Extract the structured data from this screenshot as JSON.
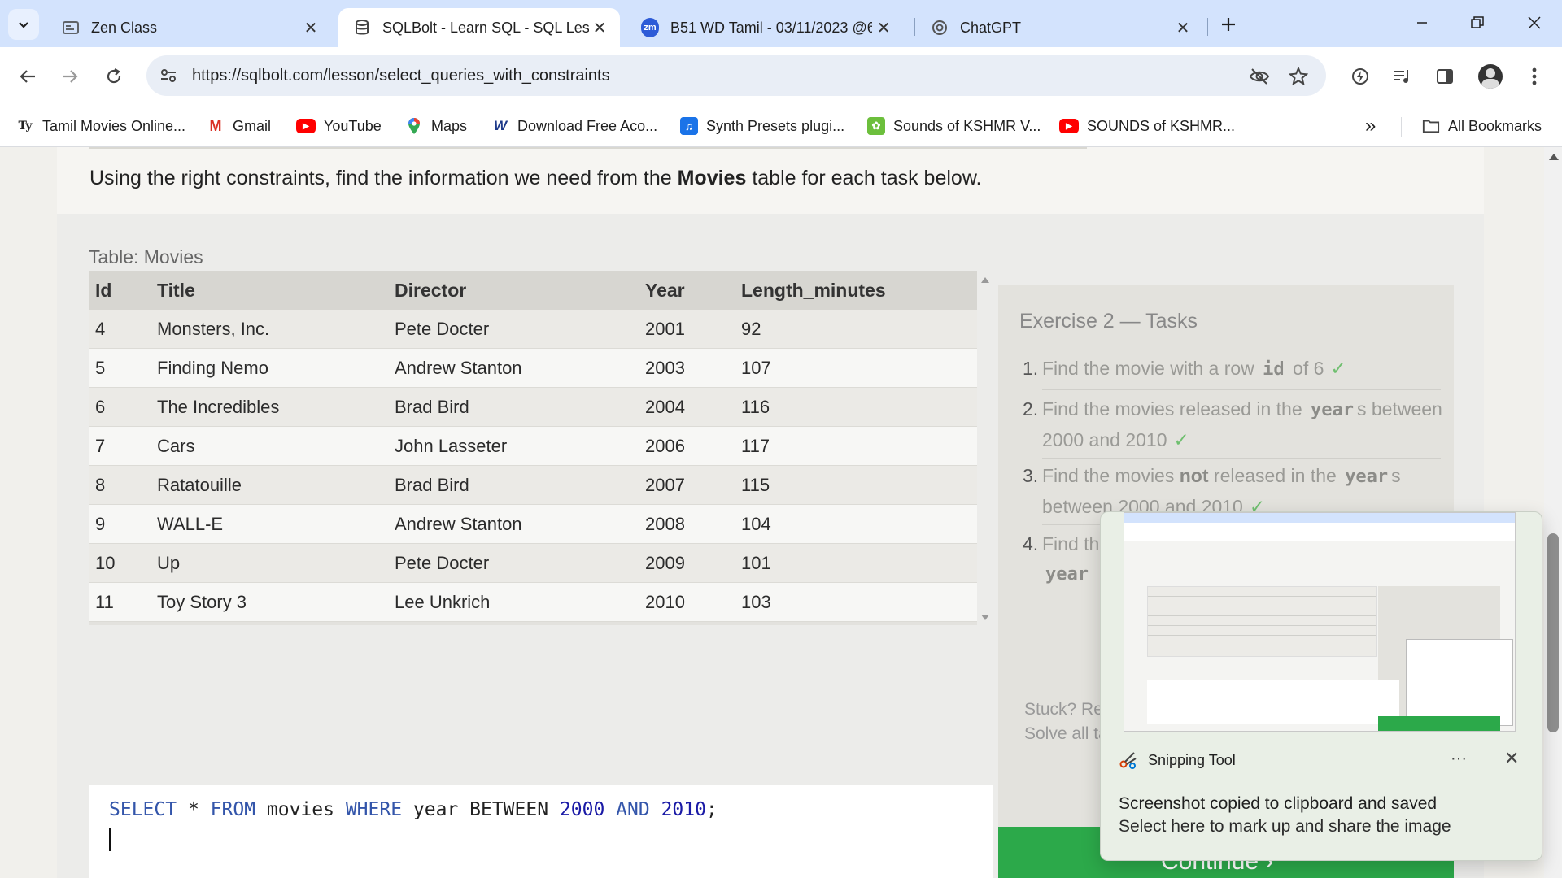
{
  "browser": {
    "tabs": [
      {
        "title": "Zen Class",
        "icon": "zen-class-icon",
        "active": false
      },
      {
        "title": "SQLBolt - Learn SQL - SQL Lesso",
        "icon": "database-icon",
        "active": true
      },
      {
        "title": "B51 WD Tamil - 03/11/2023 @6",
        "icon": "zoom-icon",
        "active": false
      },
      {
        "title": "ChatGPT",
        "icon": "chatgpt-icon",
        "active": false
      }
    ],
    "zoom_badge": "zm",
    "url": "https://sqlbolt.com/lesson/select_queries_with_constraints",
    "bookmarks": [
      {
        "label": "Tamil Movies Online...",
        "icon": "ty-icon",
        "glyph": "Ty"
      },
      {
        "label": "Gmail",
        "icon": "gmail-icon",
        "glyph": "M"
      },
      {
        "label": "YouTube",
        "icon": "youtube-icon",
        "glyph": "▶"
      },
      {
        "label": "Maps",
        "icon": "maps-pin-icon",
        "glyph": ""
      },
      {
        "label": "Download Free Aco...",
        "icon": "wix-icon",
        "glyph": "W"
      },
      {
        "label": "Synth Presets plugi...",
        "icon": "music-note-icon",
        "glyph": "♫"
      },
      {
        "label": "Sounds of KSHMR V...",
        "icon": "splice-icon",
        "glyph": "✿"
      },
      {
        "label": "SOUNDS of KSHMR...",
        "icon": "youtube-icon",
        "glyph": "▶"
      }
    ],
    "overflow_label": "»",
    "all_bookmarks_label": "All Bookmarks"
  },
  "page": {
    "intro_prefix": "Using the right constraints, find the information we need from the ",
    "intro_bold": "Movies",
    "intro_suffix": " table for each task below.",
    "table_caption": "Table: Movies",
    "columns": [
      "Id",
      "Title",
      "Director",
      "Year",
      "Length_minutes"
    ],
    "rows": [
      [
        "4",
        "Monsters, Inc.",
        "Pete Docter",
        "2001",
        "92"
      ],
      [
        "5",
        "Finding Nemo",
        "Andrew Stanton",
        "2003",
        "107"
      ],
      [
        "6",
        "The Incredibles",
        "Brad Bird",
        "2004",
        "116"
      ],
      [
        "7",
        "Cars",
        "John Lasseter",
        "2006",
        "117"
      ],
      [
        "8",
        "Ratatouille",
        "Brad Bird",
        "2007",
        "115"
      ],
      [
        "9",
        "WALL-E",
        "Andrew Stanton",
        "2008",
        "104"
      ],
      [
        "10",
        "Up",
        "Pete Docter",
        "2009",
        "101"
      ],
      [
        "11",
        "Toy Story 3",
        "Lee Unkrich",
        "2010",
        "103"
      ]
    ],
    "query": {
      "kw_select": "SELECT",
      "star": " * ",
      "kw_from": "FROM",
      "table": " movies ",
      "kw_where": "WHERE",
      "col": " year BETWEEN ",
      "n1": "2000",
      "kw_and": " AND ",
      "n2": "2010",
      "end": ";"
    },
    "exercise_title": "Exercise 2 — Tasks",
    "tasks": [
      {
        "num": "1.",
        "a": "Find the movie with a row ",
        "code": "id",
        "b": " of 6",
        "check": "✓"
      },
      {
        "num": "2.",
        "a": "Find the movies released in the ",
        "code": "year",
        "b": "s between 2000 and 2010",
        "check": "✓"
      },
      {
        "num": "3.",
        "a": "Find the movies ",
        "strong": "not",
        "a2": " released in the ",
        "code": "year",
        "b": "s between 2000 and 2010",
        "check": "✓"
      },
      {
        "num": "4.",
        "a": "Find th",
        "code": "year"
      }
    ],
    "stuck_line1": "Stuck? Rea",
    "stuck_line2": "Solve all ta",
    "continue_label": "Continue ›"
  },
  "snipping_tool": {
    "app_name": "Snipping Tool",
    "more_label": "···",
    "close_label": "✕",
    "title": "Screenshot copied to clipboard and saved",
    "subtitle": "Select here to mark up and share the image"
  },
  "colors": {
    "tabstrip": "#d3e3fd",
    "continue_green": "#2ca94a",
    "sql_keyword": "#3355aa",
    "check_green": "#6fbf6f"
  }
}
